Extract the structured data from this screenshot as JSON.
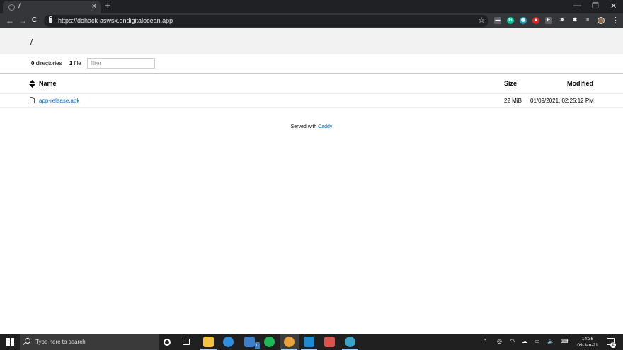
{
  "browser": {
    "tab_title": "/",
    "tab_close": "×",
    "new_tab": "+",
    "window_minimize": "—",
    "window_restore": "❐",
    "window_close": "✕",
    "url": "https://dohack-aswsx.ondigitalocean.app",
    "back": "←",
    "forward": "→",
    "reload": "C",
    "star": "☆",
    "menu": "⋮",
    "extensions": [
      {
        "icon": "wallet-icon",
        "color": "#5f6368",
        "glyph": "▬"
      },
      {
        "icon": "grammarly-icon",
        "color": "#15c39a",
        "glyph": "G"
      },
      {
        "icon": "grepper-icon",
        "color": "#18a3b8",
        "glyph": "◉"
      },
      {
        "icon": "lastpass-icon",
        "color": "#d32d27",
        "glyph": "●"
      },
      {
        "icon": "evernote-icon",
        "color": "#5f6368",
        "glyph": "E"
      },
      {
        "icon": "react-devtools-icon",
        "color": "#35363a",
        "glyph": "⚛"
      },
      {
        "icon": "puzzle-icon",
        "color": "#35363a",
        "glyph": "✱"
      },
      {
        "icon": "playlist-icon",
        "color": "#35363a",
        "glyph": "≡"
      }
    ]
  },
  "listing": {
    "path": "/",
    "directories_count": "0",
    "directories_label": "directories",
    "files_count": "1",
    "files_label": "file",
    "filter_placeholder": "filter",
    "columns": {
      "name": "Name",
      "size": "Size",
      "modified": "Modified"
    },
    "rows": [
      {
        "name": "app-release.apk",
        "size": "22 MiB",
        "modified": "01/09/2021, 02:25:12 PM"
      }
    ],
    "footer_text": "Served with",
    "footer_link": "Caddy"
  },
  "taskbar": {
    "search_placeholder": "Type here to search",
    "apps": [
      {
        "icon": "cortana-icon",
        "color": "#202020"
      },
      {
        "icon": "task-view-icon",
        "color": "#202020"
      },
      {
        "icon": "file-explorer-icon",
        "color": "#f5c242"
      },
      {
        "icon": "edge-icon",
        "color": "#2f8fdc"
      },
      {
        "icon": "mail-icon",
        "color": "#3e7fc9"
      },
      {
        "icon": "spotify-icon",
        "color": "#1db954"
      },
      {
        "icon": "chrome-icon",
        "color": "#e8a33c"
      },
      {
        "icon": "vscode-icon",
        "color": "#1f8ad2"
      },
      {
        "icon": "snipping-tool-icon",
        "color": "#d9534f"
      },
      {
        "icon": "app-icon",
        "color": "#3aa3c7"
      }
    ],
    "mail_badge": "11",
    "time": "14:36",
    "date": "09-Jan-21",
    "notification_count": "2",
    "tray": {
      "chevron": "^",
      "speaker": "🔈"
    }
  }
}
